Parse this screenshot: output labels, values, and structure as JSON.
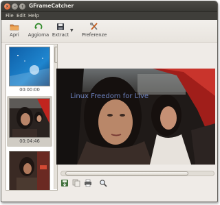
{
  "window": {
    "title": "GFrameCatcher"
  },
  "menubar": {
    "items": [
      "File",
      "Edit",
      "Help"
    ]
  },
  "toolbar": {
    "open_label": "Apri",
    "refresh_label": "Aggiorna",
    "extract_label": "Extract",
    "preferences_label": "Preferenze"
  },
  "thumbnails": [
    {
      "time": "00:00:00",
      "selected": false
    },
    {
      "time": "00:04:46",
      "selected": true
    },
    {
      "time": "",
      "selected": false
    }
  ],
  "preview": {
    "watermark": "Linux Freedom for Live"
  },
  "icons": {
    "open": "folder-icon",
    "refresh": "refresh-icon",
    "extract": "save-icon",
    "preferences": "tools-icon",
    "bottom": [
      "save-frame-icon",
      "copy-icon",
      "print-icon",
      "zoom-icon"
    ]
  },
  "colors": {
    "titlebar": "#3a3935",
    "window_bg": "#efebe7",
    "close_button": "#de4c16"
  }
}
